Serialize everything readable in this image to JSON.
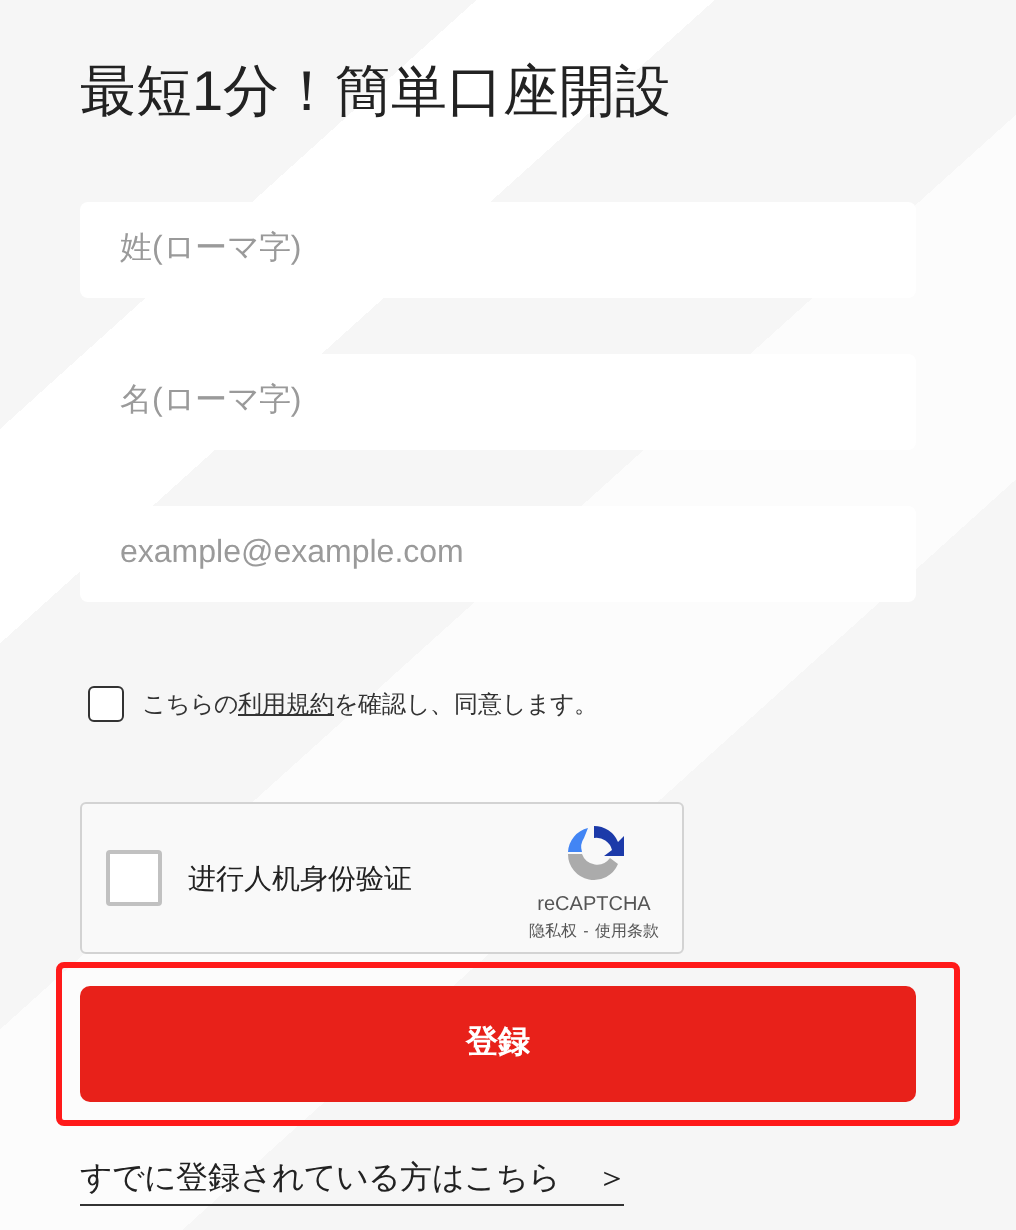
{
  "title": "最短1分！簡単口座開設",
  "fields": [
    {
      "placeholder": "姓(ローマ字)"
    },
    {
      "placeholder": "名(ローマ字)"
    },
    {
      "placeholder": "example@example.com"
    }
  ],
  "consent": {
    "checked": false,
    "before": "こちらの",
    "link": "利用規約",
    "after": "を確認し、同意します。"
  },
  "recaptcha": {
    "checked": false,
    "label": "进行人机身份验证",
    "brand": "reCAPTCHA",
    "privacy": "隐私权",
    "separator": "-",
    "terms": "使用条款"
  },
  "submit": {
    "label": "登録",
    "highlighted": true
  },
  "login_link": {
    "label": "すでに登録されている方はこちら",
    "arrow": "＞"
  }
}
